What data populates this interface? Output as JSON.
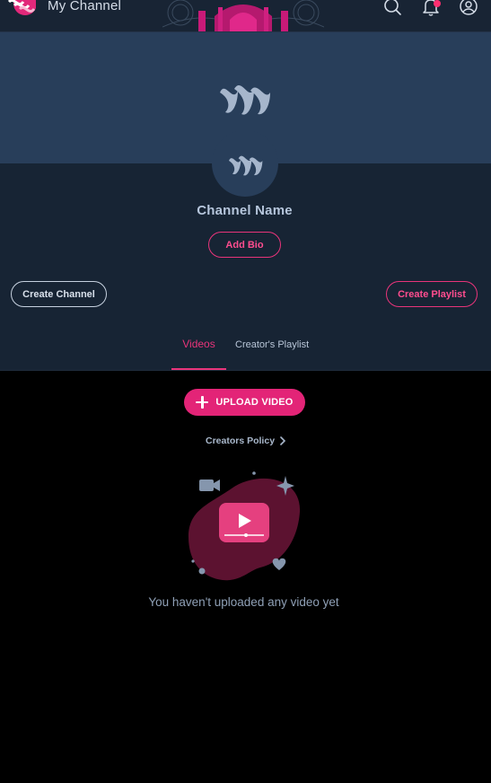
{
  "header": {
    "title": "My Channel",
    "icons": [
      "app-logo",
      "search-icon",
      "bell-icon",
      "user-icon"
    ]
  },
  "channel": {
    "name": "Channel Name",
    "add_bio_label": "Add Bio",
    "create_channel_label": "Create Channel",
    "create_playlist_label": "Create Playlist"
  },
  "tabs": [
    {
      "label": "Videos",
      "active": true
    },
    {
      "label": "Creator's Playlist",
      "active": false
    }
  ],
  "content": {
    "upload_label": "UPLOAD VIDEO",
    "policy_label": "Creators Policy",
    "empty_message": "You haven't uploaded any video yet"
  },
  "colors": {
    "accent": "#e32477",
    "header_bg": "#182434",
    "cover_bg": "#283e5a",
    "channel_bg": "#172434",
    "page_bg": "#000000"
  }
}
